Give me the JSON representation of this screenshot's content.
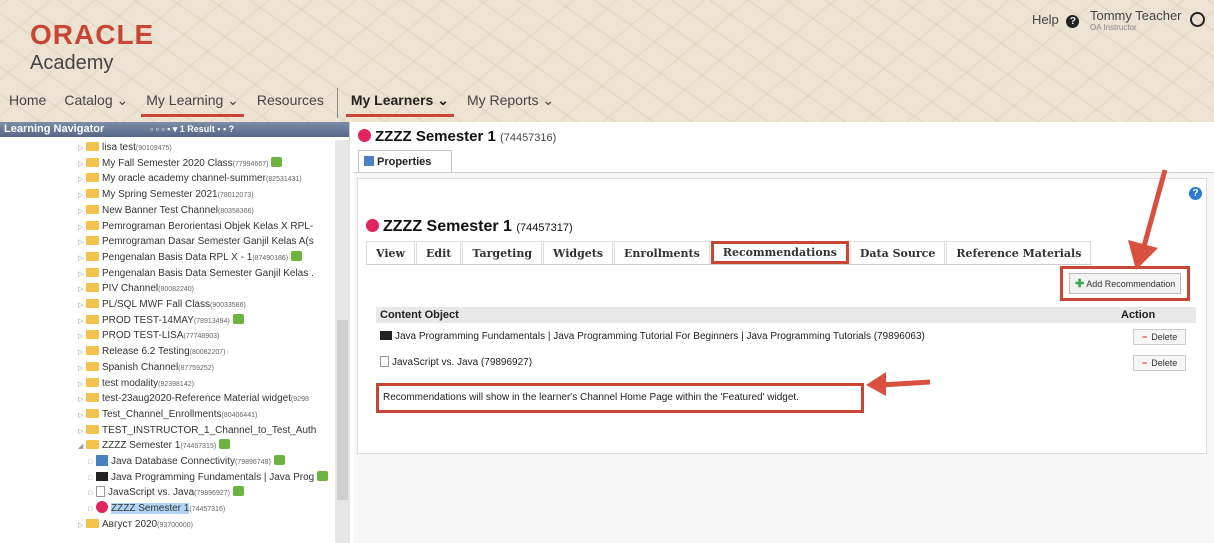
{
  "header": {
    "logo_top": "ORACLE",
    "logo_bottom": "Academy",
    "help_label": "Help",
    "user_name": "Tommy Teacher",
    "user_role": "OA Instructor"
  },
  "nav": {
    "home": "Home",
    "catalog": "Catalog ⌄",
    "my_learning": "My Learning ⌄",
    "resources": "Resources",
    "my_learners": "My Learners ⌄",
    "my_reports": "My Reports ⌄"
  },
  "navigator": {
    "title": "Learning Navigator",
    "tools": "▫ ▫ ▫ ▪ ▾ 1 Result ▪ ▪ ?"
  },
  "tree": [
    {
      "label": "lisa test",
      "id": "(90109475)"
    },
    {
      "label": "My Fall Semester 2020 Class",
      "id": "(77994667)"
    },
    {
      "label": "My oracle academy channel-summer",
      "id": "(82531431)"
    },
    {
      "label": "My Spring Semester 2021",
      "id": "(78012073)"
    },
    {
      "label": "New Banner Test Channel",
      "id": "(80358366)"
    },
    {
      "label": "Pemrograman Berorientasi Objek Kelas X RPL-",
      "id": ""
    },
    {
      "label": "Pemrograman Dasar Semester Ganjil Kelas A(s",
      "id": ""
    },
    {
      "label": "Pengenalan Basis Data RPL X - 1",
      "id": "(87490186)"
    },
    {
      "label": "Pengenalan Basis Data Semester Ganjil Kelas .",
      "id": ""
    },
    {
      "label": "PIV Channel",
      "id": "(80082240)"
    },
    {
      "label": "PL/SQL MWF Fall Class",
      "id": "(90033586)"
    },
    {
      "label": "PROD TEST-14MAY",
      "id": "(78913494)"
    },
    {
      "label": "PROD TEST-LISA",
      "id": "(77748903)"
    },
    {
      "label": "Release 6.2 Testing",
      "id": "(80082207)"
    },
    {
      "label": "Spanish Channel",
      "id": "(87759252)"
    },
    {
      "label": "test modality",
      "id": "(92398142)"
    },
    {
      "label": "test-23aug2020-Reference Material widget",
      "id": "(9298"
    },
    {
      "label": "Test_Channel_Enrollments",
      "id": "(80406441)"
    },
    {
      "label": "TEST_INSTRUCTOR_1_Channel_to_Test_Auth",
      "id": ""
    },
    {
      "label": "ZZZZ Semester 1",
      "id": "(74457315)"
    },
    {
      "label": "Java Database Connectivity",
      "id": "(79896748)"
    },
    {
      "label": "Java Programming Fundamentals | Java Prog",
      "id": ""
    },
    {
      "label": "JavaScript vs. Java",
      "id": "(79896927)"
    },
    {
      "label": "ZZZZ Semester 1",
      "id": "(74457316)"
    },
    {
      "label": "Август 2020",
      "id": "(93700000)"
    }
  ],
  "main": {
    "title": "ZZZZ Semester 1",
    "title_id": "(74457316)",
    "properties_tab": "Properties",
    "card_title": "ZZZZ Semester 1",
    "card_id": "(74457317)",
    "tabs": [
      "View",
      "Edit",
      "Targeting",
      "Widgets",
      "Enrollments",
      "Recommendations",
      "Data Source",
      "Reference Materials"
    ],
    "add_recommendation": "Add Recommendation",
    "col_content": "Content Object",
    "col_action": "Action",
    "rows": [
      {
        "label": "Java Programming Fundamentals | Java Programming Tutorial For Beginners | Java Programming Tutorials (79896063)",
        "action": "Delete"
      },
      {
        "label": "JavaScript vs. Java (79896927)",
        "action": "Delete"
      }
    ],
    "note": "Recommendations will show in the learner's Channel Home Page within the 'Featured' widget."
  }
}
